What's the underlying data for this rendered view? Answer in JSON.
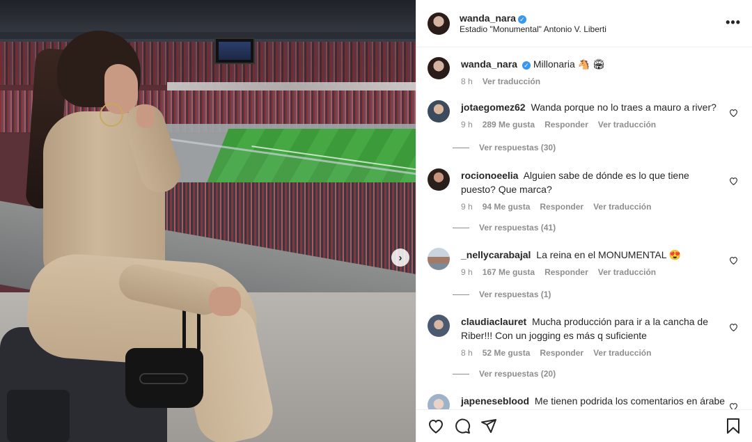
{
  "post": {
    "author": "wanda_nara",
    "verified_mark": "✓",
    "location": "Estadio \"Monumental\" Antonio V. Liberti",
    "more_icon": "more-horizontal-icon",
    "more_label": "•••",
    "next_label": "›"
  },
  "caption": {
    "user": "wanda_nara",
    "text": "Millonaria 🐴 🏟",
    "time": "8 h",
    "translate": "Ver traducción"
  },
  "comments": [
    {
      "user": "jotaegomez62",
      "text": "Wanda porque no lo traes a mauro a river?",
      "time": "9 h",
      "likes": "289 Me gusta",
      "reply": "Responder",
      "translate": "Ver traducción",
      "replies": "Ver respuestas (30)"
    },
    {
      "user": "rocionoeelia",
      "text": "Alguien sabe de dónde es lo que tiene puesto? Que marca?",
      "time": "9 h",
      "likes": "94 Me gusta",
      "reply": "Responder",
      "translate": "Ver traducción",
      "replies": "Ver respuestas (41)"
    },
    {
      "user": "_nellycarabajal",
      "text": "La reina en el MONUMENTAL 😍",
      "time": "9 h",
      "likes": "167 Me gusta",
      "reply": "Responder",
      "translate": "Ver traducción",
      "replies": "Ver respuestas (1)"
    },
    {
      "user": "claudiaclauret",
      "text": "Mucha producción para ir a la cancha de Riber!!! Con un jogging es más q suficiente",
      "time": "8 h",
      "likes": "52 Me gusta",
      "reply": "Responder",
      "translate": "Ver traducción",
      "replies": "Ver respuestas (20)"
    },
    {
      "user": "japeneseblood",
      "text": "Me tienen podrida los comentarios en árabe"
    }
  ],
  "icons": {
    "like": "heart-icon",
    "comment": "comment-icon",
    "share": "share-icon",
    "save": "bookmark-icon"
  },
  "colors": {
    "verified": "#3897f0",
    "muted": "#8e8e8e",
    "text": "#262626"
  }
}
